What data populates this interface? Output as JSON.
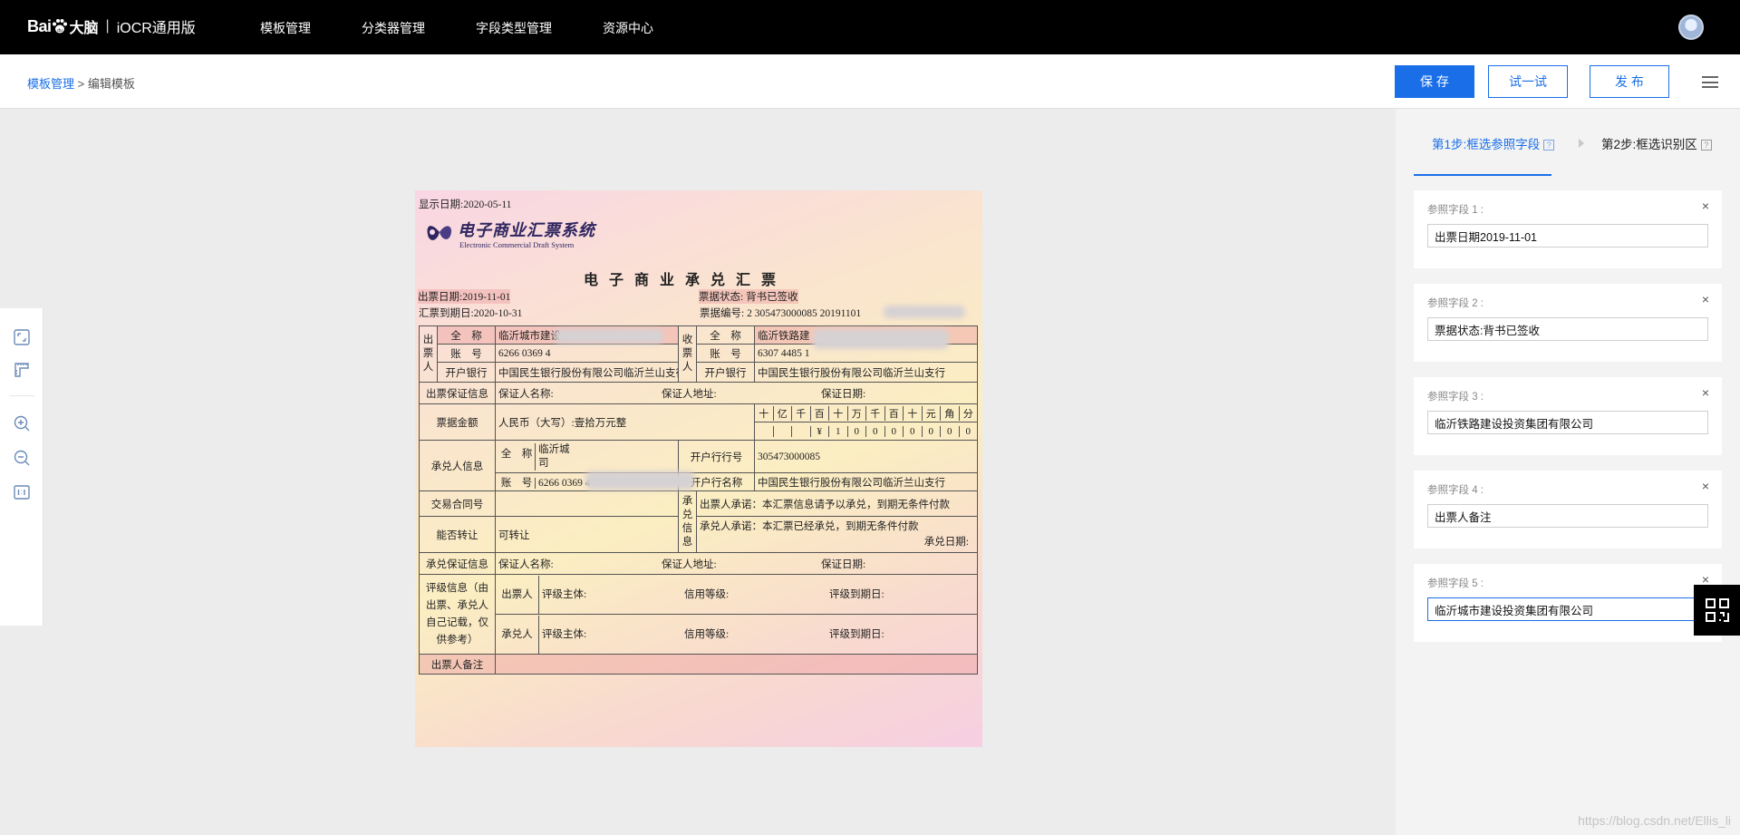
{
  "header": {
    "logo_brand": "Bai",
    "logo_suffix": "大脑",
    "product_name": "iOCR通用版",
    "nav": [
      "模板管理",
      "分类器管理",
      "字段类型管理",
      "资源中心"
    ]
  },
  "subheader": {
    "breadcrumb_root": "模板管理",
    "breadcrumb_sep": " > ",
    "breadcrumb_current": "编辑模板",
    "save_label": "保 存",
    "try_label": "试一试",
    "publish_label": "发 布"
  },
  "panel": {
    "step1": "第1步:框选参照字段",
    "step2": "第2步:框选识别区",
    "help_glyph": "?",
    "fields": [
      {
        "label": "参照字段 1 :",
        "value": "出票日期2019-11-01"
      },
      {
        "label": "参照字段 2 :",
        "value": "票据状态:背书已签收"
      },
      {
        "label": "参照字段 3 :",
        "value": "临沂铁路建设投资集团有限公司"
      },
      {
        "label": "参照字段 4 :",
        "value": "出票人备注"
      },
      {
        "label": "参照字段 5 :",
        "value": "临沂城市建设投资集团有限公司"
      }
    ],
    "close_glyph": "×"
  },
  "draft": {
    "display_date": "显示日期:2020-05-11",
    "brand_cn": "电子商业汇票系统",
    "brand_en": "Electronic Commercial Draft System",
    "title": "电子商业承兑汇票",
    "issue_date": "出票日期:2019-11-01",
    "status": "票据状态: 背书已签收",
    "due_date": "汇票到期日:2020-10-31",
    "bill_no": "票据编号: 2 305473000085 20191101",
    "drawer_label": [
      "出",
      "票",
      "人"
    ],
    "payee_label": [
      "收",
      "票",
      "人"
    ],
    "full_name_label": "全　称",
    "account_label": "账　号",
    "bank_label": "开户银行",
    "drawer_name": "临沂城市建设",
    "drawer_account": "6266 0369 4",
    "drawer_bank": "中国民生银行股份有限公司临沂兰山支行",
    "payee_name": "临沂铁路建",
    "payee_account": "6307 4485 1",
    "payee_bank": "中国民生银行股份有限公司临沂兰山支行",
    "guarantee_label": "出票保证信息",
    "guarantor_name": "保证人名称:",
    "guarantor_addr": "保证人地址:",
    "guarantee_date": "保证日期:",
    "amount_label": "票据金额",
    "amount_text": "人民币（大写）:壹拾万元整",
    "digit_units": [
      "十",
      "亿",
      "千",
      "百",
      "十",
      "万",
      "千",
      "百",
      "十",
      "元",
      "角",
      "分"
    ],
    "digit_values": [
      "",
      "",
      "",
      "¥",
      "1",
      "0",
      "0",
      "0",
      "0",
      "0",
      "0",
      "0"
    ],
    "acceptor_label": "承兑人信息",
    "acceptor_name_1": "临沂城",
    "acceptor_name_2": "司",
    "acceptor_account": "6266 0369 4",
    "acceptor_bank_no_label": "开户行行号",
    "acceptor_bank_no": "305473000085",
    "acceptor_bank_name_label": "开户行名称",
    "acceptor_bank_name": "中国民生银行股份有限公司临沂兰山支行",
    "contract_label": "交易合同号",
    "transferable_label": "能否转让",
    "transferable_value": "可转让",
    "accept_info_label": [
      "承",
      "兑",
      "信",
      "息"
    ],
    "drawer_promise": "出票人承诺：本汇票信息请予以承兑，到期无条件付款",
    "acceptor_promise": "承兑人承诺：本汇票已经承兑，到期无条件付款",
    "accept_date": "承兑日期:",
    "accept_guarantee_label": "承兑保证信息",
    "rating_label_lines": [
      "评级信息（由",
      "出票、承兑人",
      "自己记载，仅",
      "供参考）"
    ],
    "rating_drawer": "出票人",
    "rating_acceptor": "承兑人",
    "rating_subject": "评级主体:",
    "credit_level": "信用等级:",
    "rating_due": "评级到期日:",
    "drawer_remark": "出票人备注"
  },
  "watermark": "https://blog.csdn.net/Ellis_li"
}
